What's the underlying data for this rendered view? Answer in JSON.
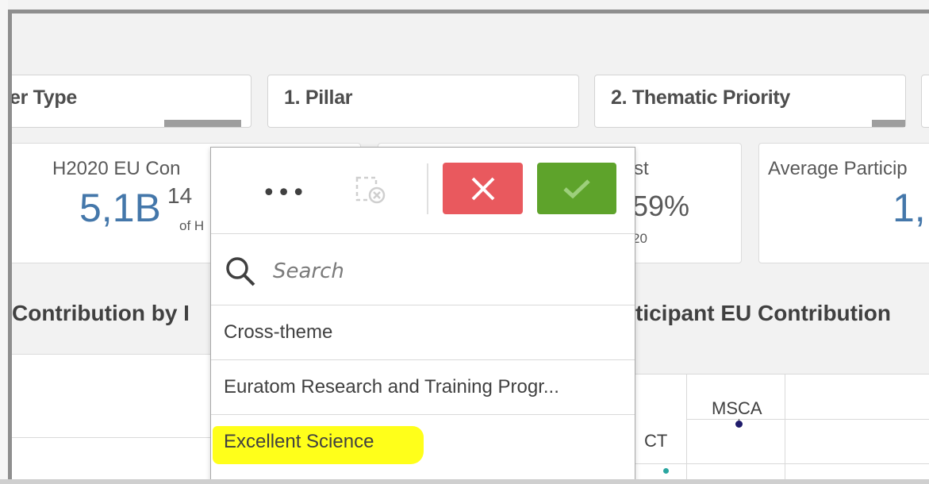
{
  "filters": {
    "partner_type": "er Type",
    "pillar": "1. Pillar",
    "thematic_priority": "2. Thematic Priority"
  },
  "kpis": {
    "contribution_title": "H2020 EU Con",
    "contribution_value": "5,1B",
    "contribution_superscript": "14",
    "contribution_sub": "of H",
    "second_title": "st",
    "second_value": "59%",
    "second_sub": "20",
    "average_title": "Average Particip",
    "average_value": "1,"
  },
  "panels": {
    "left_title": "Contribution by I",
    "right_title": "ticipant EU Contribution",
    "scatter_label_msca": "MSCA",
    "scatter_label_ict": "CT"
  },
  "popup": {
    "more_label": "•••",
    "search_placeholder": "Search",
    "items": [
      {
        "label": "Cross-theme"
      },
      {
        "label": "Euratom Research and Training Progr..."
      },
      {
        "label": "Excellent Science"
      }
    ]
  },
  "colors": {
    "cancel": "#e9595e",
    "confirm": "#5ea32b",
    "kpi_value": "#4477aa",
    "highlight": "#ffff1a",
    "point_msca": "#1f1b6b",
    "point_ict": "#2aa6a0"
  }
}
